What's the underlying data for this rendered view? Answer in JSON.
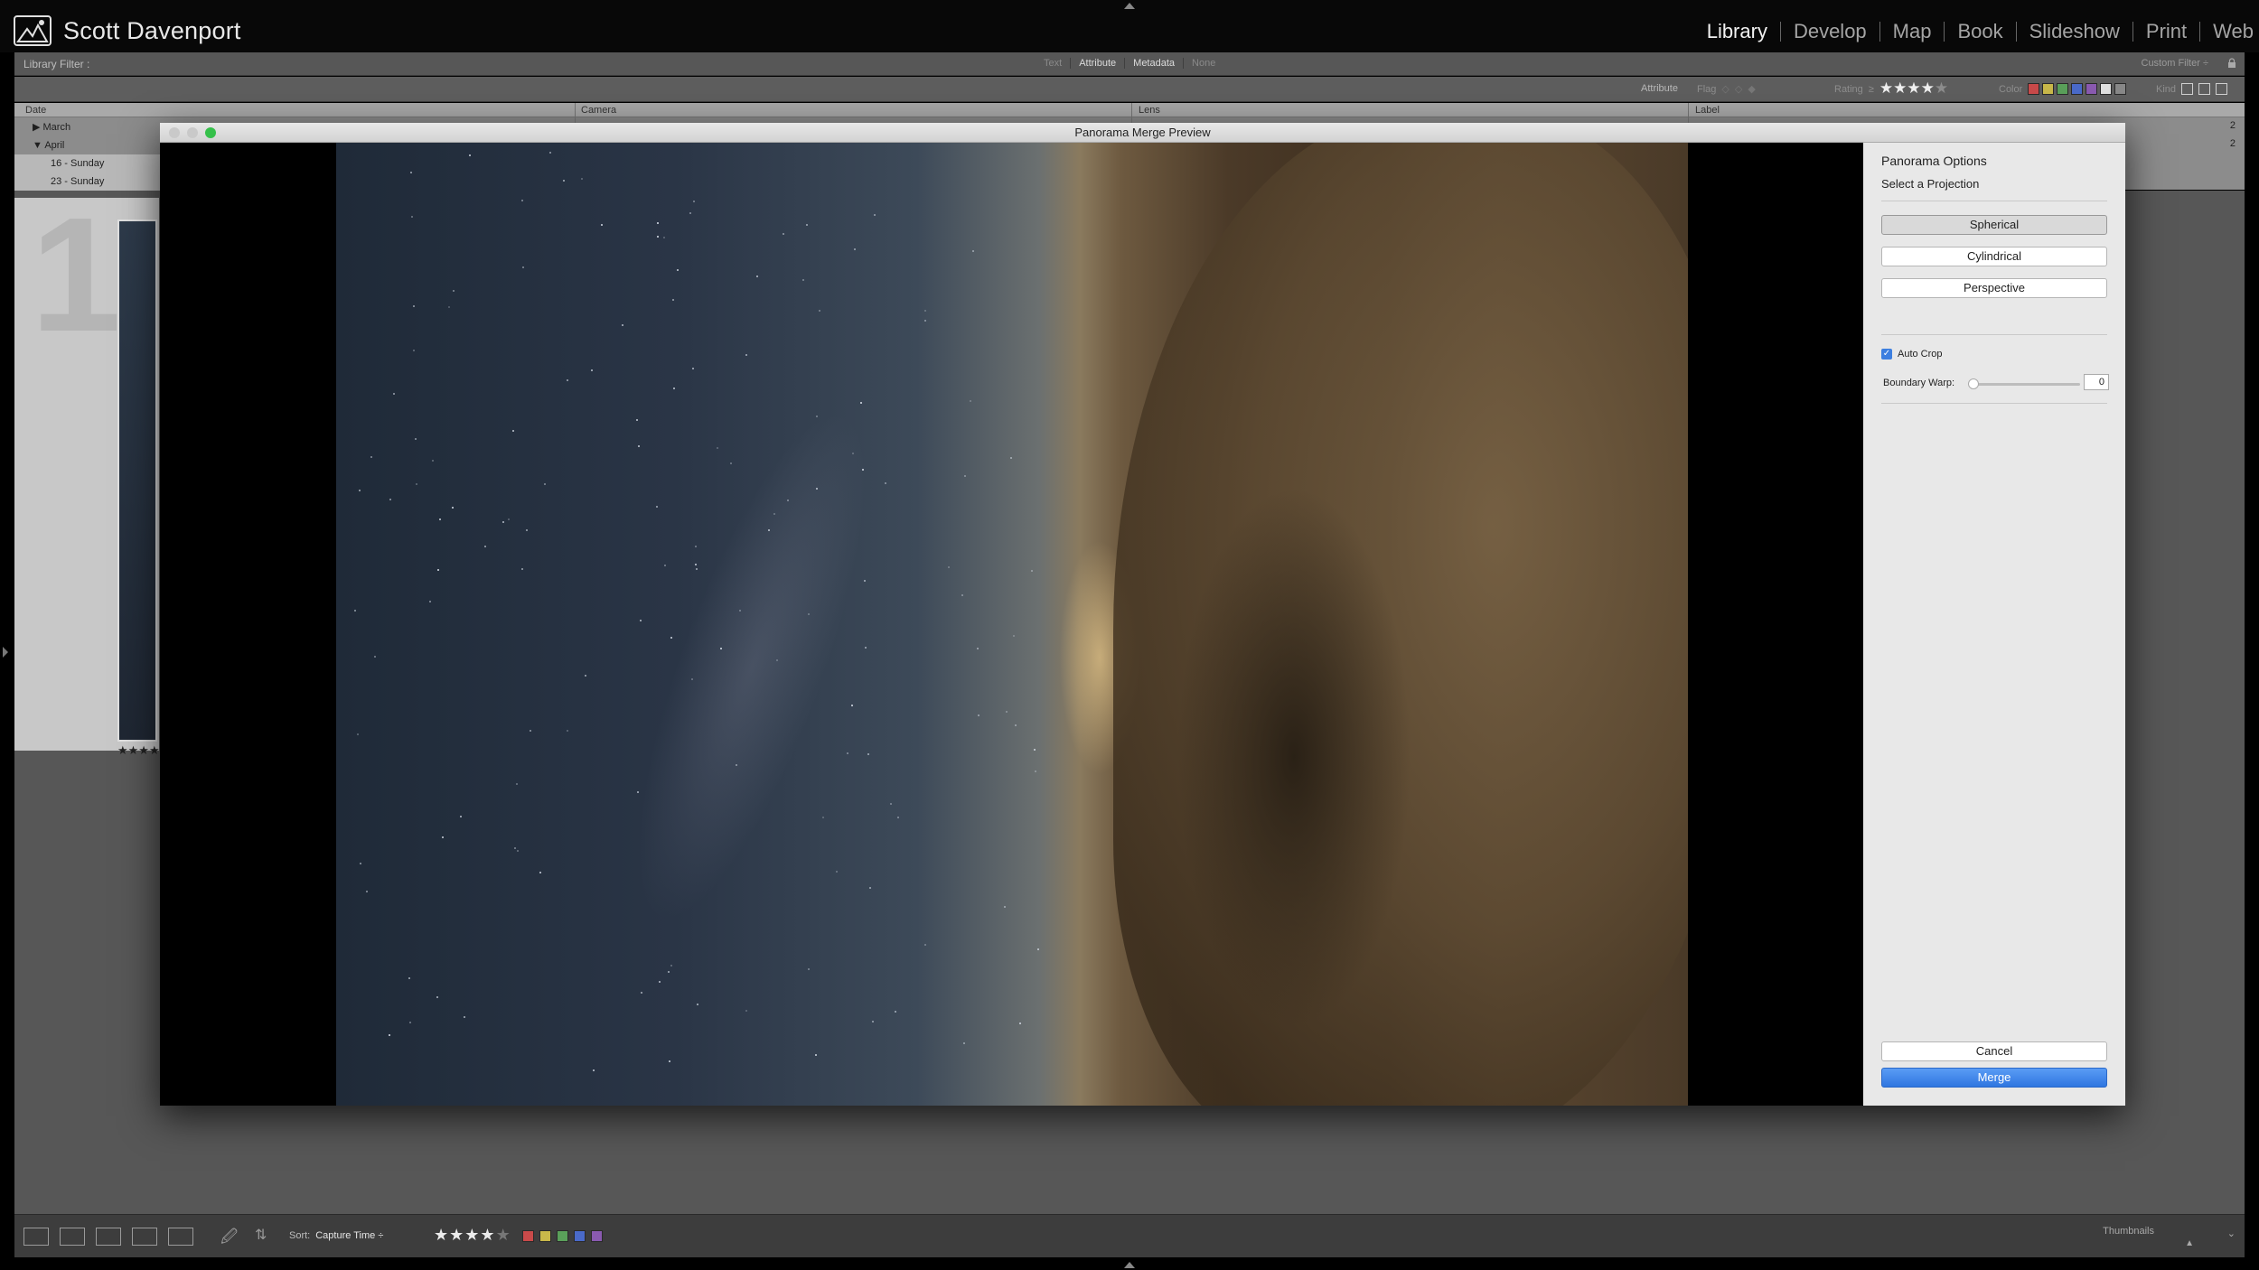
{
  "identity": {
    "name": "Scott Davenport"
  },
  "modules": [
    "Library",
    "Develop",
    "Map",
    "Book",
    "Slideshow",
    "Print",
    "Web"
  ],
  "active_module": "Library",
  "filter_bar": {
    "label": "Library Filter :",
    "tabs": [
      "Text",
      "Attribute",
      "Metadata",
      "None"
    ],
    "custom_filter": "Custom Filter ÷"
  },
  "attribute_bar": {
    "attribute_label": "Attribute",
    "flag_label": "Flag",
    "rating_label": "Rating",
    "rating_op": "≥",
    "rating_value": 4,
    "color_label": "Color",
    "kind_label": "Kind",
    "colors": [
      "#c94a4a",
      "#c9b84a",
      "#5aa05a",
      "#4a6ac9",
      "#8a5ab0",
      "#e0e0e0",
      "#888888"
    ]
  },
  "metadata": {
    "columns": [
      "Date",
      "Camera",
      "Lens",
      "Label"
    ],
    "date_rows": [
      "March",
      "April",
      "16 - Sunday",
      "23 - Sunday"
    ],
    "counts": [
      "2",
      "2"
    ]
  },
  "grid": {
    "cell_number": "1",
    "thumb_stars": "★★★★"
  },
  "toolbar": {
    "sort_label": "Sort:",
    "sort_value": "Capture Time ÷",
    "rating_value": 4,
    "colors": [
      "#c94a4a",
      "#c9b84a",
      "#5aa05a",
      "#4a6ac9",
      "#8a5ab0"
    ],
    "thumbnails_label": "Thumbnails"
  },
  "dialog": {
    "title": "Panorama Merge Preview",
    "options_heading": "Panorama Options",
    "projection_heading": "Select a Projection",
    "projections": [
      "Spherical",
      "Cylindrical",
      "Perspective"
    ],
    "selected_projection": "Spherical",
    "auto_crop_label": "Auto Crop",
    "auto_crop_checked": true,
    "boundary_warp_label": "Boundary Warp:",
    "boundary_warp_value": "0",
    "cancel_label": "Cancel",
    "merge_label": "Merge"
  }
}
